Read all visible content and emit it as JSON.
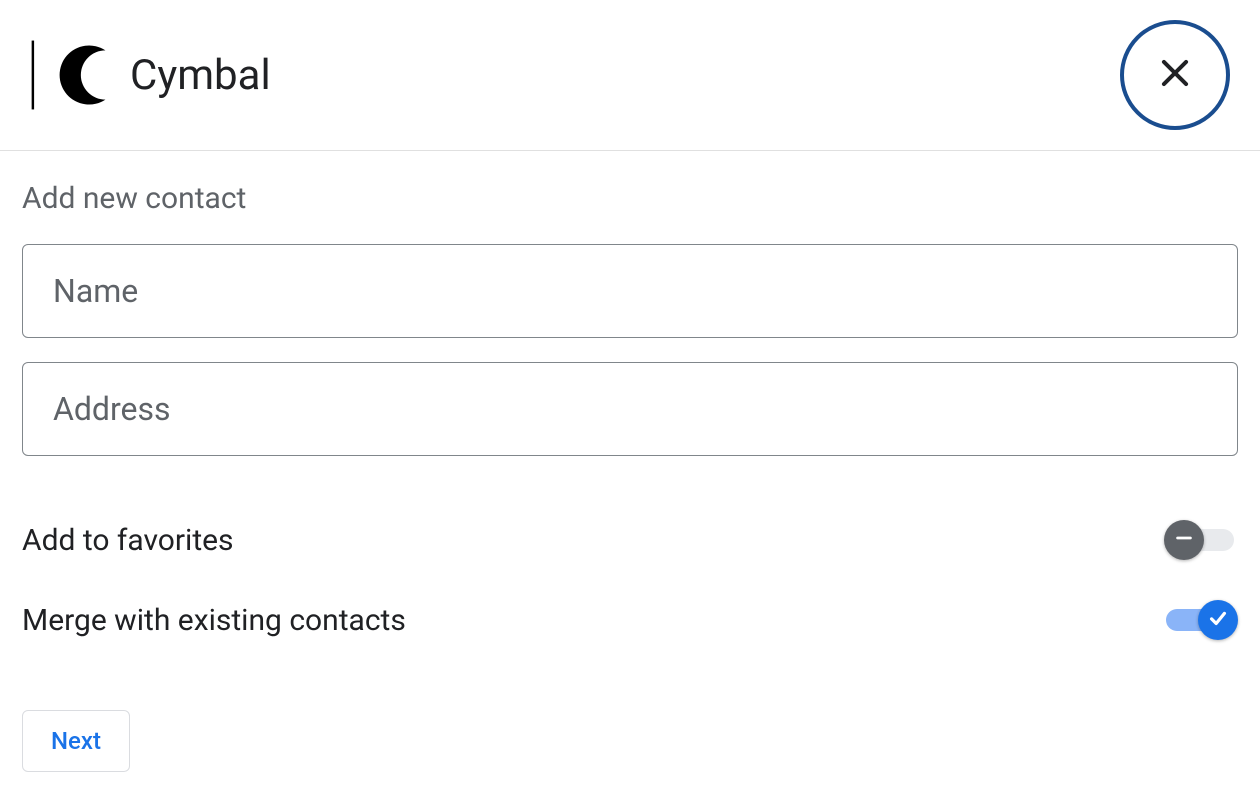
{
  "header": {
    "brand_name": "Cymbal"
  },
  "form": {
    "title": "Add new contact",
    "name_placeholder": "Name",
    "name_value": "",
    "address_placeholder": "Address",
    "address_value": "",
    "favorites_label": "Add to favorites",
    "favorites_on": false,
    "merge_label": "Merge with existing contacts",
    "merge_on": true,
    "next_label": "Next"
  }
}
